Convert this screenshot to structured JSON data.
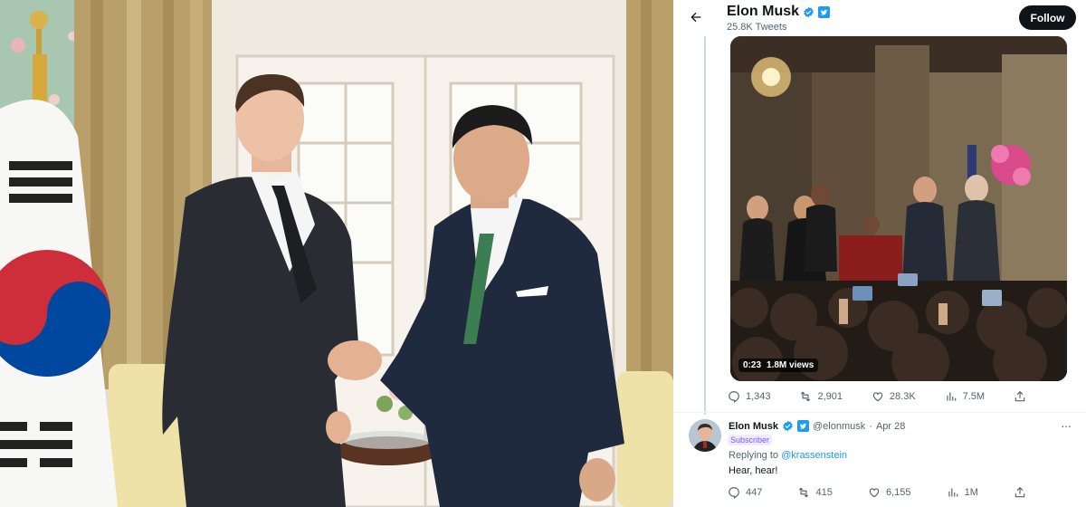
{
  "colors": {
    "accent": "#1d9bf0",
    "text_primary": "#0f1419",
    "text_secondary": "#536471",
    "follow_button_bg": "#0f1419",
    "subscriber_badge": "#7856ff",
    "verified_badge": "#1d9bf0"
  },
  "profile_header": {
    "back_icon": "arrow-left-icon",
    "name": "Elon Musk",
    "badges": [
      "verified-badge-icon",
      "twitter-affiliate-icon"
    ],
    "tweet_count": "25.8K Tweets",
    "follow_label": "Follow"
  },
  "main_tweet": {
    "video": {
      "duration": "0:23",
      "views": "1.8M views"
    },
    "actions": [
      {
        "icon": "reply-icon",
        "count": "1,343"
      },
      {
        "icon": "retweet-icon",
        "count": "2,901"
      },
      {
        "icon": "like-icon",
        "count": "28.3K"
      },
      {
        "icon": "views-icon",
        "count": "7.5M"
      },
      {
        "icon": "share-icon",
        "count": ""
      }
    ]
  },
  "reply_tweet": {
    "name": "Elon Musk",
    "handle": "@elonmusk",
    "separator": "·",
    "date": "Apr 28",
    "subscriber_label": "Subscriber",
    "replying_prefix": "Replying to",
    "replying_to": "@krassenstein",
    "text": "Hear, hear!",
    "more_icon": "more-options-icon",
    "more_label": "···",
    "actions": [
      {
        "icon": "reply-icon",
        "count": "447"
      },
      {
        "icon": "retweet-icon",
        "count": "415"
      },
      {
        "icon": "like-icon",
        "count": "6,155"
      },
      {
        "icon": "views-icon",
        "count": "1M"
      },
      {
        "icon": "share-icon",
        "count": ""
      }
    ]
  }
}
